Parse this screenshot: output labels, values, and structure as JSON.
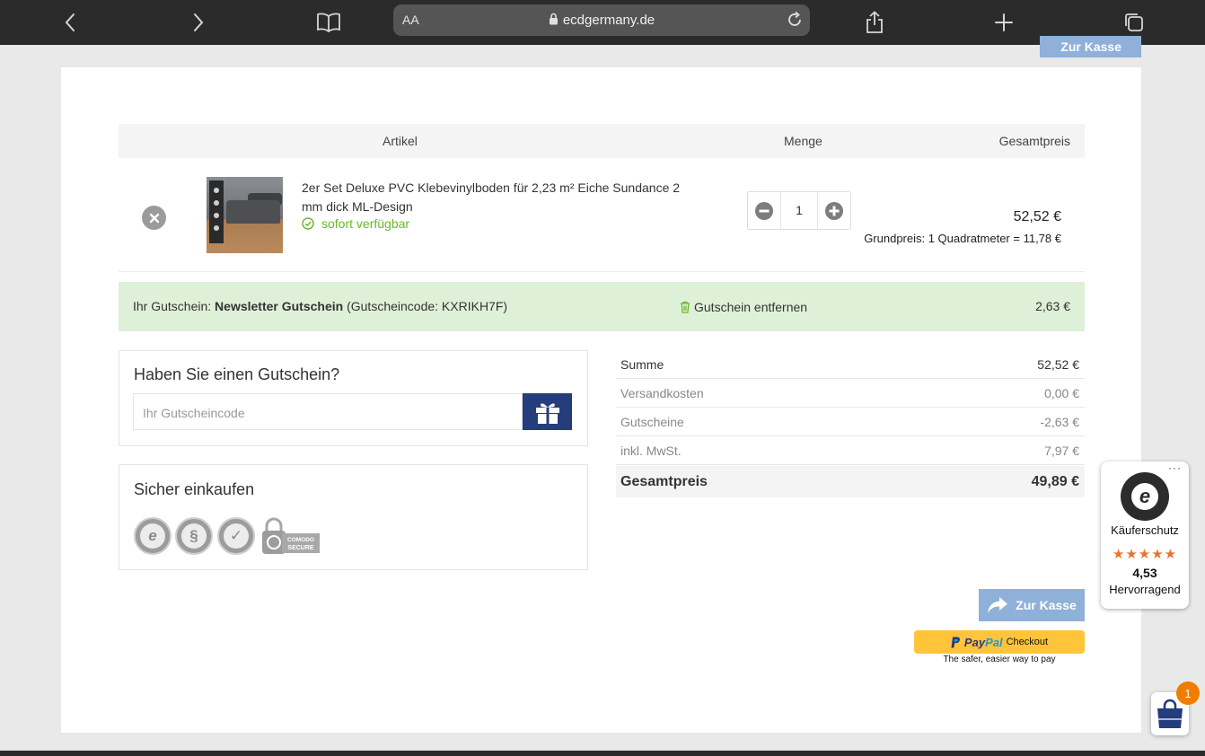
{
  "browser": {
    "aa_label": "AA",
    "url_host": "ecdgermany.de"
  },
  "header_button_partial": "Zur Kasse",
  "table": {
    "headers": {
      "article": "Artikel",
      "quantity": "Menge",
      "total": "Gesamtpreis"
    }
  },
  "item": {
    "title": "2er Set Deluxe PVC Klebevinylboden für 2,23 m² Eiche Sundance 2 mm dick ML-Design",
    "availability": "sofort verfügbar",
    "quantity": "1",
    "price": "52,52 €",
    "base_price": "Grundpreis: 1 Quadratmeter = 11,78 €"
  },
  "voucher_applied": {
    "prefix": "Ihr Gutschein: ",
    "name": "Newsletter Gutschein",
    "code_text": " (Gutscheincode: KXRIKH7F)",
    "remove_label": "Gutschein entfernen",
    "amount": "2,63 €"
  },
  "coupon_box": {
    "title": "Haben Sie einen Gutschein?",
    "placeholder": "Ihr Gutscheincode"
  },
  "secure_box": {
    "title": "Sicher einkaufen"
  },
  "summary": {
    "rows": [
      {
        "label": "Summe",
        "value": "52,52 €",
        "color": "#333333"
      },
      {
        "label": "Versandkosten",
        "value": "0,00 €",
        "color": "#888888"
      },
      {
        "label": "Gutscheine",
        "value": "-2,63 €",
        "color": "#888888"
      },
      {
        "label": "inkl. MwSt.",
        "value": "7,97 €",
        "color": "#888888"
      }
    ],
    "total_label": "Gesamtpreis",
    "total_value": "49,89 €"
  },
  "checkout_button": "Zur Kasse",
  "paypal": {
    "pay": "Pay",
    "pal": "Pal",
    "checkout": "Checkout",
    "tagline": "The safer, easier way to pay"
  },
  "trusted_shops": {
    "label": "Käuferschutz",
    "stars": "★★★★★",
    "score": "4,53",
    "rating_text": "Hervorragend"
  },
  "cart_count": "1",
  "colors": {
    "accent_blue": "#253c7d",
    "checkout_blue": "#8fb0d8",
    "success_green": "#6ab825",
    "voucher_bg": "#dff0d8",
    "badge_orange": "#f07d00"
  }
}
